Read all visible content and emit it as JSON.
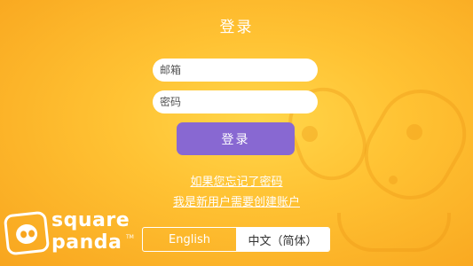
{
  "header": {
    "title": "登录"
  },
  "form": {
    "email_placeholder": "邮箱",
    "password_placeholder": "密码",
    "login_label": "登录"
  },
  "links": {
    "forgot_password": "如果您忘记了密码",
    "new_user": "我是新用户需要创建账户"
  },
  "logo": {
    "line1": "square",
    "line2": "panda",
    "trademark": "TM"
  },
  "language": {
    "options": [
      "English",
      "中文（简体）"
    ],
    "selected": "中文（简体）"
  },
  "colors": {
    "background": "#ffc233",
    "button": "#8868d2",
    "text": "#ffffff"
  }
}
